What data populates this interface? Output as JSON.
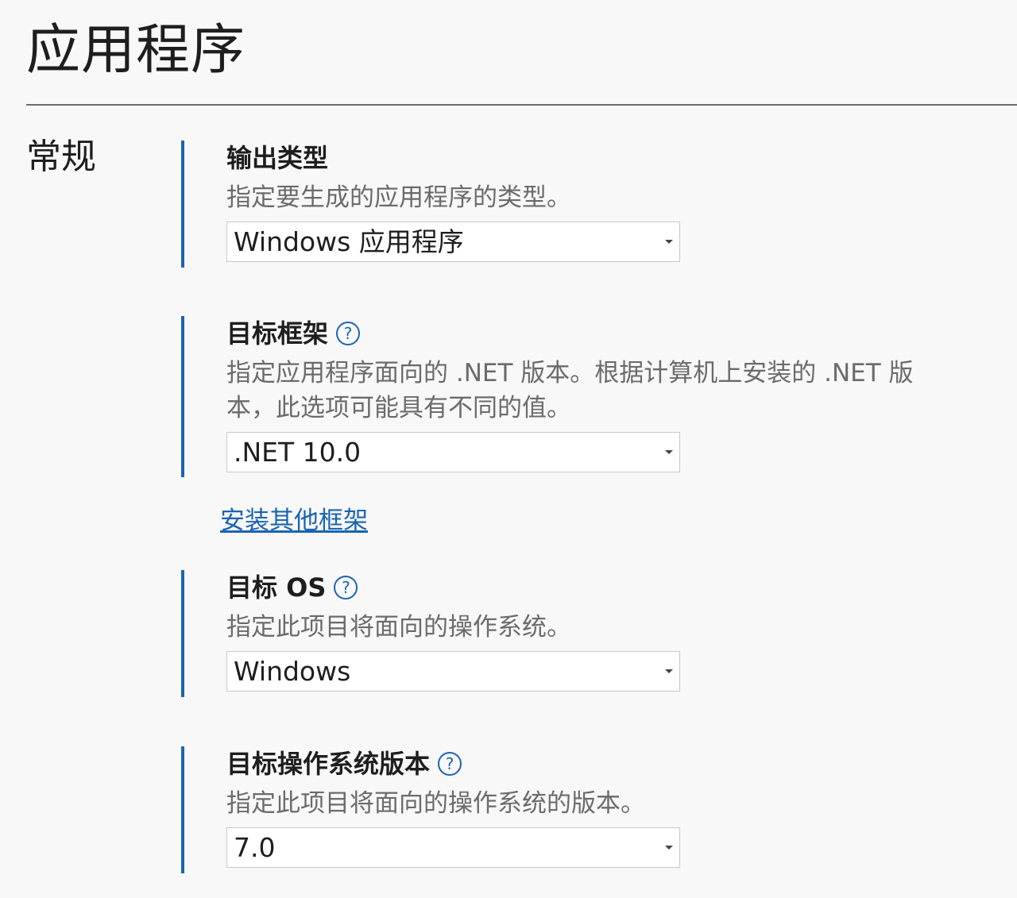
{
  "page": {
    "title": "应用程序",
    "section_label": "常规"
  },
  "properties": [
    {
      "title": "输出类型",
      "description": "指定要生成的应用程序的类型。",
      "value": "Windows 应用程序"
    },
    {
      "title": "目标框架",
      "description": "指定应用程序面向的 .NET 版本。根据计算机上安装的 .NET 版本，此选项可能具有不同的值。",
      "value": ".NET 10.0"
    },
    {
      "title": "目标 OS",
      "description": "指定此项目将面向的操作系统。",
      "value": "Windows"
    },
    {
      "title": "目标操作系统版本",
      "description": "指定此项目将面向的操作系统的版本。",
      "value": "7.0"
    }
  ],
  "install_link": "安装其他框架",
  "icons": {
    "help": "?",
    "help_icon_name": "question-circle-icon",
    "dropdown_icon_name": "chevron-down-icon"
  },
  "colors": {
    "accent": "#1a64b4",
    "background": "#f8f8f8",
    "description_text": "#6b6b6b"
  }
}
